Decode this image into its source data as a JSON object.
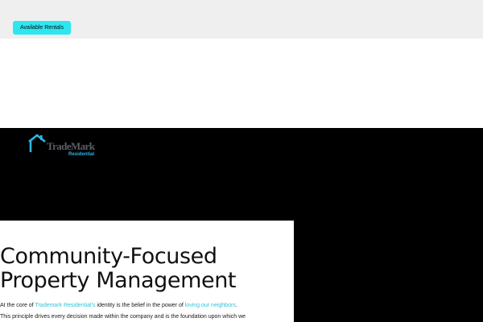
{
  "header": {
    "rentals_button_label": "Available Rentals"
  },
  "logo": {
    "name": "TradeMark",
    "subtitle": "Residential"
  },
  "main": {
    "headline_line1": "Community-Focused",
    "headline_line2": "Property Management",
    "body": {
      "line1_prefix": "At the core of ",
      "brand_link": "Trademark Residential's",
      "line1_middle": " identity is the belief in the power of ",
      "neighbors_link": "loving our neighbors",
      "line1_suffix": ".",
      "line2": "This principle drives every decision made within the company and is the foundation upon which we"
    }
  },
  "colors": {
    "accent": "#2ee6f0",
    "link": "#2ec3d8",
    "logo_blue": "#2bb8e6",
    "hero_background": "#000000",
    "topbar_background": "#efefef"
  }
}
